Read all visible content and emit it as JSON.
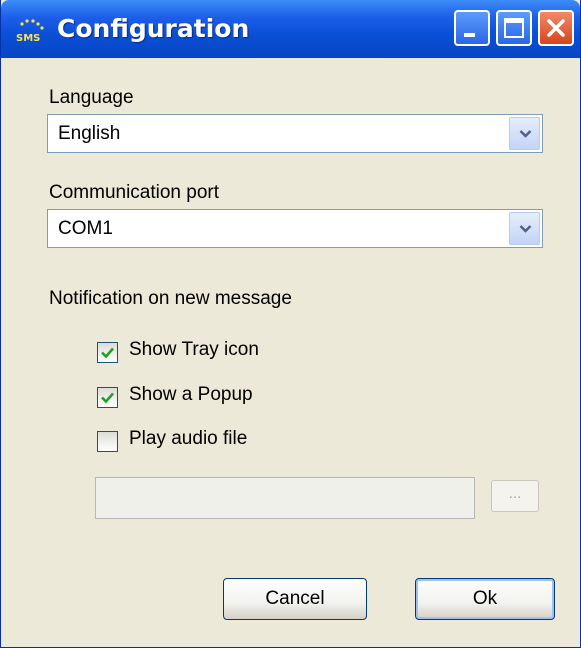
{
  "window": {
    "title": "Configuration",
    "icon_name": "sms-app-icon",
    "icon_text": "SMS",
    "controls": [
      "minimize-icon",
      "maximize-icon",
      "close-icon"
    ]
  },
  "language": {
    "label": "Language",
    "selected": "English"
  },
  "port": {
    "label": "Communication port",
    "selected": "COM1"
  },
  "notification": {
    "heading": "Notification on new message",
    "options": [
      {
        "label": "Show Tray icon",
        "checked": true
      },
      {
        "label": "Show a Popup",
        "checked": true
      },
      {
        "label": "Play audio file",
        "checked": false
      }
    ],
    "audio_file_path": "",
    "browse_label": "..."
  },
  "buttons": {
    "cancel": "Cancel",
    "ok": "Ok"
  },
  "colors": {
    "titlebar": "#0a4fd6",
    "window_bg": "#ece9d8",
    "close_button": "#d8441c",
    "checkmark": "#21a121"
  }
}
